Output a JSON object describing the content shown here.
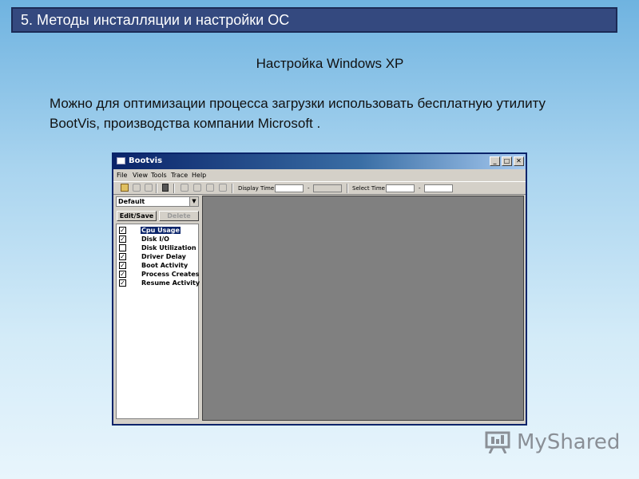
{
  "slide": {
    "header": "5. Методы инсталляции и настройки ОС",
    "subtitle": "Настройка Windows XP",
    "body": "Можно для оптимизации процесса загрузки использовать бесплатную утилиту BootVis, производства компании Microsoft ."
  },
  "window": {
    "title": "Bootvis",
    "controls": {
      "minimize": "_",
      "maximize": "□",
      "close": "✕"
    },
    "menu": [
      "File",
      "View",
      "Tools",
      "Trace",
      "Help"
    ],
    "toolbar": {
      "display_time_label": "Display Time",
      "select_time_label": "Select Time",
      "range_separator": "-"
    },
    "profile_select": {
      "value": "Default",
      "arrow": "▼"
    },
    "buttons": {
      "edit_save": "Edit/Save",
      "delete": "Delete"
    },
    "graphs": [
      {
        "label": "Cpu Usage",
        "checked": true,
        "selected": true
      },
      {
        "label": "Disk I/O",
        "checked": true,
        "selected": false
      },
      {
        "label": "Disk Utilization",
        "checked": false,
        "selected": false
      },
      {
        "label": "Driver Delay",
        "checked": true,
        "selected": false
      },
      {
        "label": "Boot Activity",
        "checked": true,
        "selected": false
      },
      {
        "label": "Process Creates",
        "checked": true,
        "selected": false
      },
      {
        "label": "Resume Activity",
        "checked": true,
        "selected": false
      }
    ]
  },
  "watermark": {
    "text": "MyShared"
  },
  "colors": {
    "header_bg": "#34497f",
    "titlebar": "#0a246a",
    "graph_area": "#808080"
  }
}
